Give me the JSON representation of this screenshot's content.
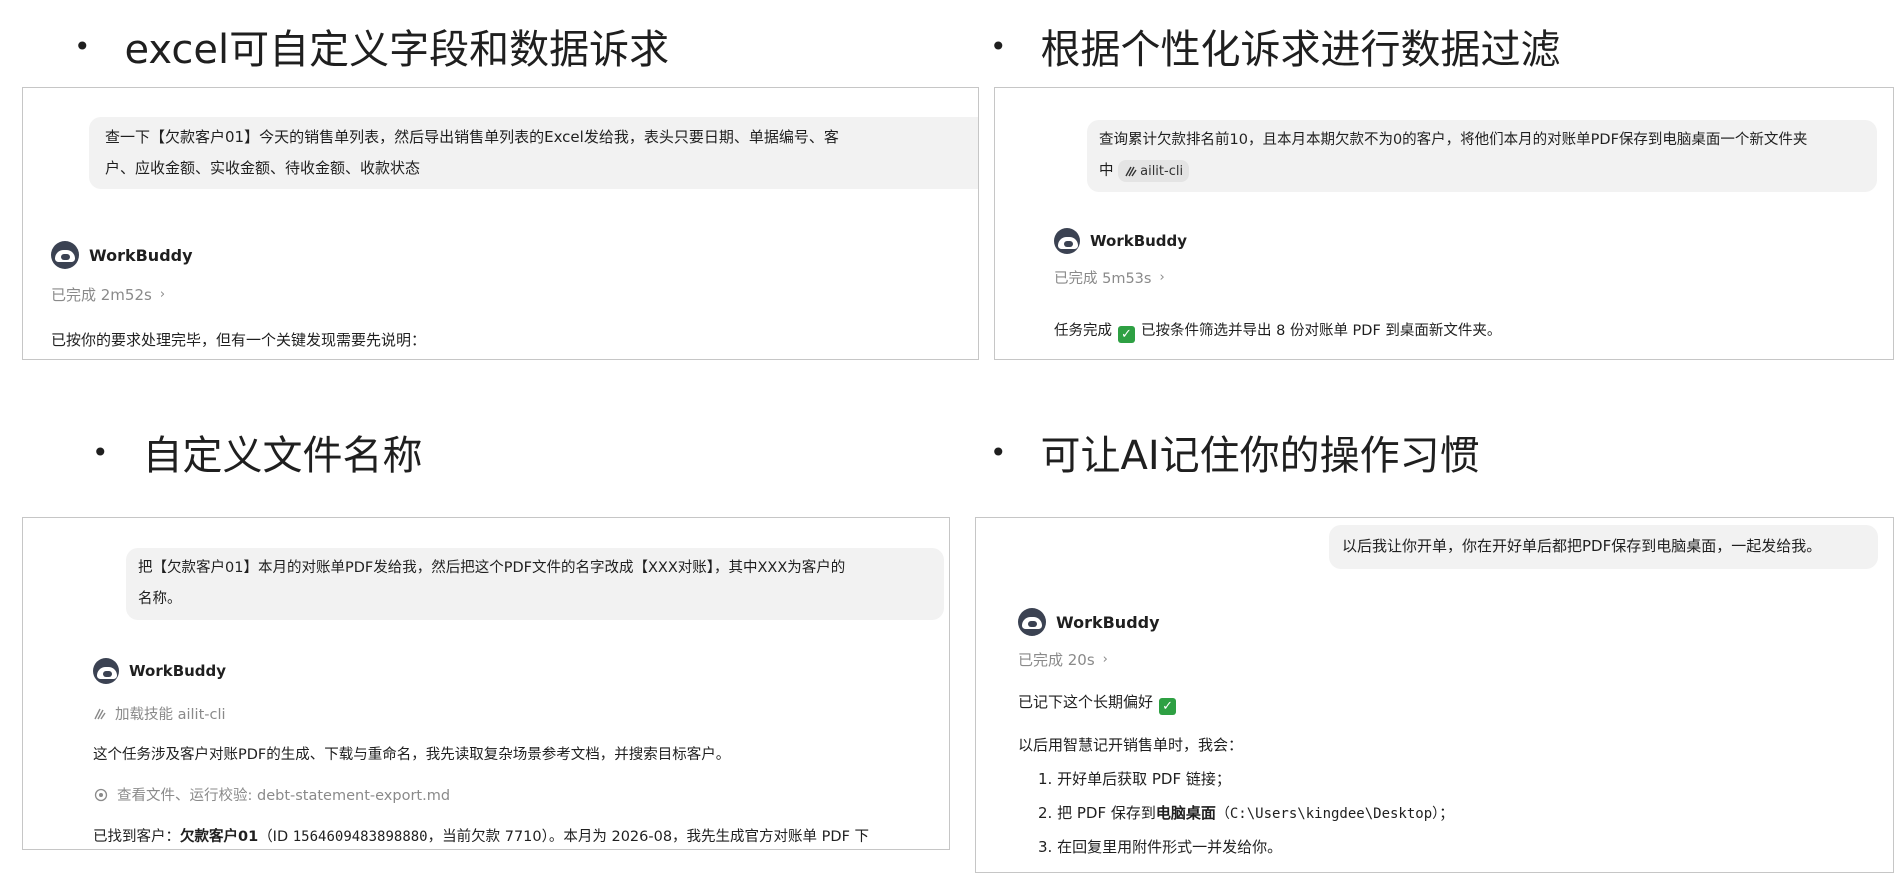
{
  "q1": {
    "title": "excel可自定义字段和数据诉求",
    "user_line1": "查一下【欠款客户01】今天的销售单列表，然后导出销售单列表的Excel发给我，表头只要日期、单据编号、客",
    "user_line2": "户、应收金额、实收金额、待收金额、收款状态",
    "agent_name": "WorkBuddy",
    "status": "已完成 2m52s",
    "reply": "已按你的要求处理完毕，但有一个关键发现需要先说明："
  },
  "q2": {
    "title": "根据个性化诉求进行数据过滤",
    "user_line1": "查询累计欠款排名前10，且本月本期欠款不为0的客户，将他们本月的对账单PDF保存到电脑桌面一个新文件夹",
    "user_line2_prefix": "中",
    "skill_chip": "ailit-cli",
    "agent_name": "WorkBuddy",
    "status": "已完成 5m53s",
    "reply_prefix": "任务完成",
    "reply_suffix": "已按条件筛选并导出 8 份对账单 PDF 到桌面新文件夹。"
  },
  "q3": {
    "title": "自定义文件名称",
    "user_line1": "把【欠款客户01】本月的对账单PDF发给我，然后把这个PDF文件的名字改成【XXX对账】，其中XXX为客户的",
    "user_line2": "名称。",
    "agent_name": "WorkBuddy",
    "skill_load": "加载技能 ailit-cli",
    "reply1": "这个任务涉及客户对账PDF的生成、下载与重命名，我先读取复杂场景参考文档，并搜索目标客户。",
    "view_files": "查看文件、运行校验: debt-statement-export.md",
    "found_prefix": "已找到客户：",
    "found_customer": "欠款客户01",
    "found_id_prefix": "（ID ",
    "found_id": "1564609483898880",
    "found_suffix": "，当前欠款 7710）。本月为 2026-08，我先生成官方对账单 PDF 下"
  },
  "q4": {
    "title": "可让AI记住你的操作习惯",
    "user_line1": "以后我让你开单，你在开好单后都把PDF保存到电脑桌面，一起发给我。",
    "agent_name": "WorkBuddy",
    "status": "已完成 20s",
    "remembered": "已记下这个长期偏好",
    "intro": "以后用智慧记开销售单时，我会：",
    "step1": "1. 开好单后获取 PDF 链接；",
    "step2_prefix": "2. 把 PDF 保存到",
    "step2_bold": "电脑桌面",
    "step2_path": "（C:\\Users\\kingdee\\Desktop）",
    "step2_suffix": "；",
    "step3": "3. 在回复里用附件形式一并发给你。"
  }
}
